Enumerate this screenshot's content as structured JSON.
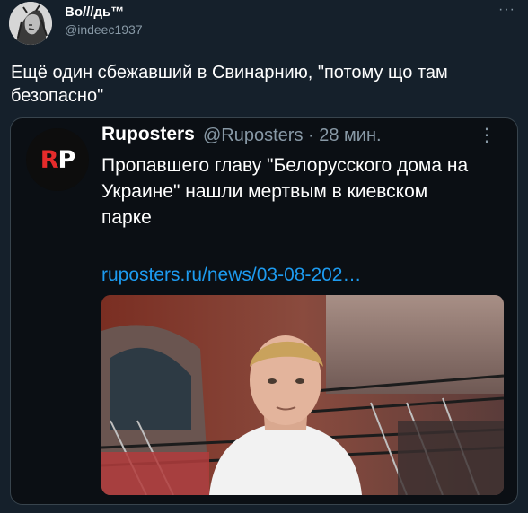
{
  "author": {
    "name": "Во///дь™",
    "handle": "@indeec1937"
  },
  "tweet": {
    "text": "Ещё один сбежавший в Свинарнию, \"потому що там безопасно\""
  },
  "more_label": "···",
  "quote": {
    "name": "Ruposters",
    "meta": "@Ruposters · 28 мин.",
    "more_label": "⋮",
    "text": "Пропавшего главу \"Белорусского дома на Украине\" нашли мертвым в киевском парке",
    "link": "ruposters.ru/news/03-08-202…",
    "logo_r": "R",
    "logo_p": "P"
  },
  "colors": {
    "background": "#15202b",
    "card": "#0b0f14",
    "link": "#1d9bf0",
    "muted": "#8899a6",
    "logo_red": "#e52b2b"
  },
  "icons": {
    "more": "ellipsis-icon",
    "quote_more": "vertical-ellipsis-icon"
  }
}
